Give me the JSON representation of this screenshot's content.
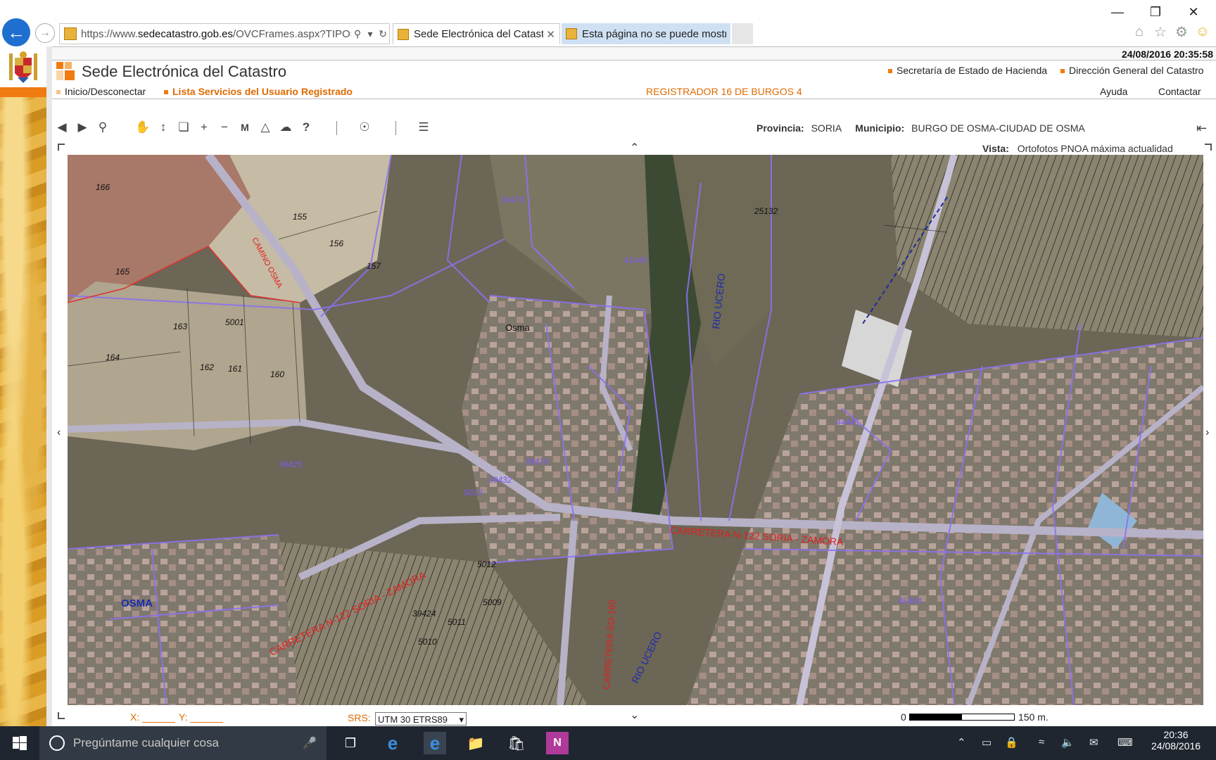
{
  "browser": {
    "url_prefix": "https://www.",
    "url_domain": "sedecatastro.gob.es",
    "url_path": "/OVCFrames.aspx?TIPO=",
    "tabs": [
      {
        "label": "Sede Electrónica del Catastro",
        "active": true
      },
      {
        "label": "Esta página no se puede mostrar",
        "active": false
      }
    ]
  },
  "header": {
    "datetime": "24/08/2016  20:35:58",
    "brand": "Sede Electrónica del Catastro",
    "links": [
      "Secretaría de Estado de Hacienda",
      "Dirección General del Catastro"
    ]
  },
  "menu": {
    "left1": "Inicio/Desconectar",
    "left2": "Lista Servicios del Usuario Registrado",
    "center": "REGISTRADOR 16 DE BURGOS 4",
    "help": "Ayuda",
    "contact": "Contactar"
  },
  "map_info": {
    "provincia_label": "Provincia:",
    "provincia": "SORIA",
    "municipio_label": "Municipio:",
    "municipio": "BURGO DE OSMA-CIUDAD DE OSMA",
    "vista_label": "Vista:",
    "vista": "Ortofotos PNOA máxima actualidad"
  },
  "map_labels": {
    "parcels": [
      "166",
      "155",
      "156",
      "157",
      "165",
      "163",
      "164",
      "162",
      "161",
      "160",
      "5001",
      "25132",
      "39479",
      "39432",
      "41449",
      "44441",
      "5011",
      "5010",
      "5009",
      "5012",
      "5013",
      "39424",
      "39425",
      "39416",
      "45404"
    ],
    "places": [
      "Osma",
      "OSMA"
    ],
    "roads": [
      "RIO UCERO",
      "RIO UCERO",
      "CARRETERA N-122 SORIA - ZAMORA",
      "CARRETERA N-122 SORIA - ZAMORA",
      "CARRETERA SO-160",
      "CAMINO OSMA"
    ]
  },
  "bottom": {
    "x_label": "X:",
    "y_label": "Y:",
    "srs_label": "SRS:",
    "srs_value": "UTM 30 ETRS89",
    "scale_zero": "0",
    "scale_value": "150 m."
  },
  "taskbar": {
    "search_placeholder": "Pregúntame cualquier cosa",
    "time": "20:36",
    "date": "24/08/2016"
  }
}
